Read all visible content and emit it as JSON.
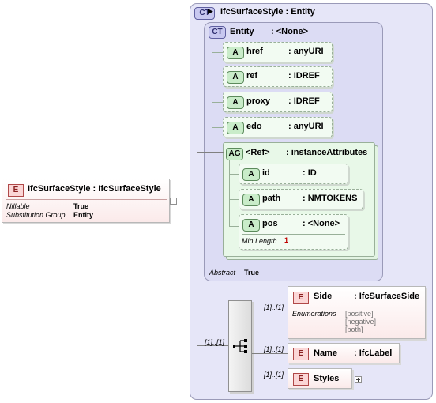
{
  "root": {
    "badge": "E",
    "label": "IfcSurfaceStyle : IfcSurfaceStyle",
    "props": [
      {
        "name": "Nillable",
        "value": "True"
      },
      {
        "name": "Substitution Group",
        "value": "Entity"
      }
    ]
  },
  "complex_type": {
    "badge": "CT",
    "title": "IfcSurfaceStyle : Entity",
    "base": {
      "badge": "CT",
      "name": "Entity",
      "type": ": <None>",
      "attributes": [
        {
          "badge": "A",
          "name": "href",
          "type": ": anyURI"
        },
        {
          "badge": "A",
          "name": "ref",
          "type": ": IDREF"
        },
        {
          "badge": "A",
          "name": "proxy",
          "type": ": IDREF"
        },
        {
          "badge": "A",
          "name": "edo",
          "type": ": anyURI"
        }
      ],
      "attribute_group": {
        "badge": "AG",
        "name": "<Ref>",
        "type": ": instanceAttributes",
        "attributes": [
          {
            "badge": "A",
            "name": "id",
            "type": ": ID"
          },
          {
            "badge": "A",
            "name": "path",
            "type": ": NMTOKENS"
          },
          {
            "badge": "A",
            "name": "pos",
            "type": ": <None>",
            "facet": {
              "name": "Min Length",
              "value": "1"
            }
          }
        ]
      },
      "abstract": {
        "name": "Abstract",
        "value": "True"
      }
    },
    "sequence": {
      "cardinality": "[1]..[1]",
      "items": [
        {
          "badge": "E",
          "name": "Side",
          "type": ": IfcSurfaceSide",
          "cardinality": "[1]..[1]",
          "enumerations_label": "Enumerations",
          "enumerations": [
            "[positive]",
            "[negative]",
            "[both]"
          ]
        },
        {
          "badge": "E",
          "name": "Name",
          "type": ": IfcLabel",
          "cardinality": "[1]..[1]"
        },
        {
          "badge": "E",
          "name": "Styles",
          "type": "",
          "cardinality": "[1]..[1]"
        }
      ]
    }
  }
}
